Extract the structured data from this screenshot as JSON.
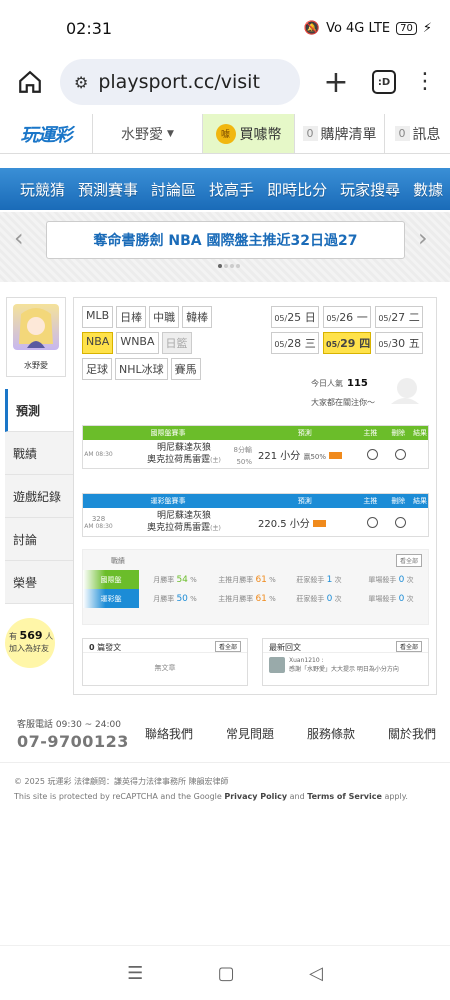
{
  "status": {
    "time": "02:31",
    "signal": "Vo 4G LTE",
    "battery": "70"
  },
  "browser": {
    "url": "playsport.cc/visit",
    "tabs_count": ":D"
  },
  "site_header": {
    "logo": "玩運彩",
    "user": "水野愛",
    "buy_coins": "買噱幣",
    "cart_count": "0",
    "cart_label": "購牌清單",
    "msg_count": "0",
    "msg_label": "訊息"
  },
  "main_nav": [
    "玩競猜",
    "預測賽事",
    "討論區",
    "找高手",
    "即時比分",
    "玩家搜尋",
    "數據"
  ],
  "banner": {
    "text": "奪命書勝劍 NBA 國際盤主推近32日過27"
  },
  "profile": {
    "name": "水野愛"
  },
  "side_tabs": [
    {
      "label": "預測",
      "active": true
    },
    {
      "label": "戰績"
    },
    {
      "label": "遊戲紀錄"
    },
    {
      "label": "討論"
    },
    {
      "label": "榮譽"
    }
  ],
  "fans": {
    "prefix": "有",
    "count": "569",
    "unit": "人",
    "suffix": "加入為好友"
  },
  "leagues": [
    [
      "MLB",
      "日棒",
      "中職",
      "韓棒"
    ],
    [
      "NBA",
      "WNBA",
      "日籃"
    ],
    [
      "足球",
      "NHL冰球",
      "賽馬"
    ]
  ],
  "dates": [
    [
      {
        "day": "05/",
        "num": "25",
        "wd": "日"
      },
      {
        "day": "05/",
        "num": "26",
        "wd": "一"
      },
      {
        "day": "05/",
        "num": "27",
        "wd": "二"
      }
    ],
    [
      {
        "day": "05/",
        "num": "28",
        "wd": "三"
      },
      {
        "day": "05/",
        "num": "29",
        "wd": "四"
      },
      {
        "day": "05/",
        "num": "30",
        "wd": "五"
      }
    ]
  ],
  "popularity": {
    "label": "今日人氣",
    "value": "115",
    "focus": "大家都在關注你～"
  },
  "table_headers": {
    "intl_title": "國際盤賽事",
    "local_title": "運彩盤賽事",
    "prediction": "預測",
    "main": "主推",
    "cancel": "刪除",
    "result": "結果"
  },
  "intl_row": {
    "time": "AM 08:30",
    "team1": "明尼蘇達灰狼",
    "team2": "奧克拉荷馬雷霆",
    "team2_suffix": "(主)",
    "odds": "8分輸",
    "odds_pct": "50%",
    "pick": "221 小分",
    "pick_pct": "贏50%"
  },
  "local_row": {
    "game_no": "328",
    "time": "AM 08:30",
    "team1": "明尼蘇達灰狼",
    "team2": "奧克拉荷馬雷霆",
    "team2_suffix": "(主)",
    "pick": "220.5 小分"
  },
  "stats": {
    "title": "戰績",
    "more": "看全部",
    "rows": [
      {
        "type": "國際盤",
        "month_label": "月勝率",
        "month": "54",
        "main_label": "主推月勝率",
        "main": "61",
        "king_label": "莊家殺手",
        "king": "1",
        "single_label": "單場殺手",
        "single": "0",
        "unit": "%",
        "times": "次"
      },
      {
        "type": "運彩盤",
        "month_label": "月勝率",
        "month": "50",
        "main_label": "主推月勝率",
        "main": "61",
        "king_label": "莊家殺手",
        "king": "0",
        "single_label": "單場殺手",
        "single": "0",
        "unit": "%",
        "times": "次"
      }
    ]
  },
  "articles": {
    "count": "0",
    "label": "篇發文",
    "more": "看全部",
    "empty": "無文章"
  },
  "replies": {
    "label": "最新回文",
    "more": "看全部",
    "user": "Xuan1210 :",
    "text": "感謝「水野愛」大大提示 明日為小分方向"
  },
  "footer": {
    "contact_label": "客服電話 09:30 ~ 24:00",
    "phone": "07-9700123",
    "links": [
      "聯絡我們",
      "常見問題",
      "服務條款",
      "關於我們"
    ],
    "copyright": "© 2025 玩運彩 法律顧問：謙英得力法律事務所 陳韻宏律師",
    "recaptcha_pre": "This site is protected by reCAPTCHA and the Google ",
    "privacy": "Privacy Policy",
    "and": " and ",
    "terms": "Terms of Service",
    "recaptcha_post": " apply."
  },
  "colors": {
    "brand_blue": "#1a76c8",
    "green": "#6bbd2a",
    "highlight": "#ffe24a"
  }
}
